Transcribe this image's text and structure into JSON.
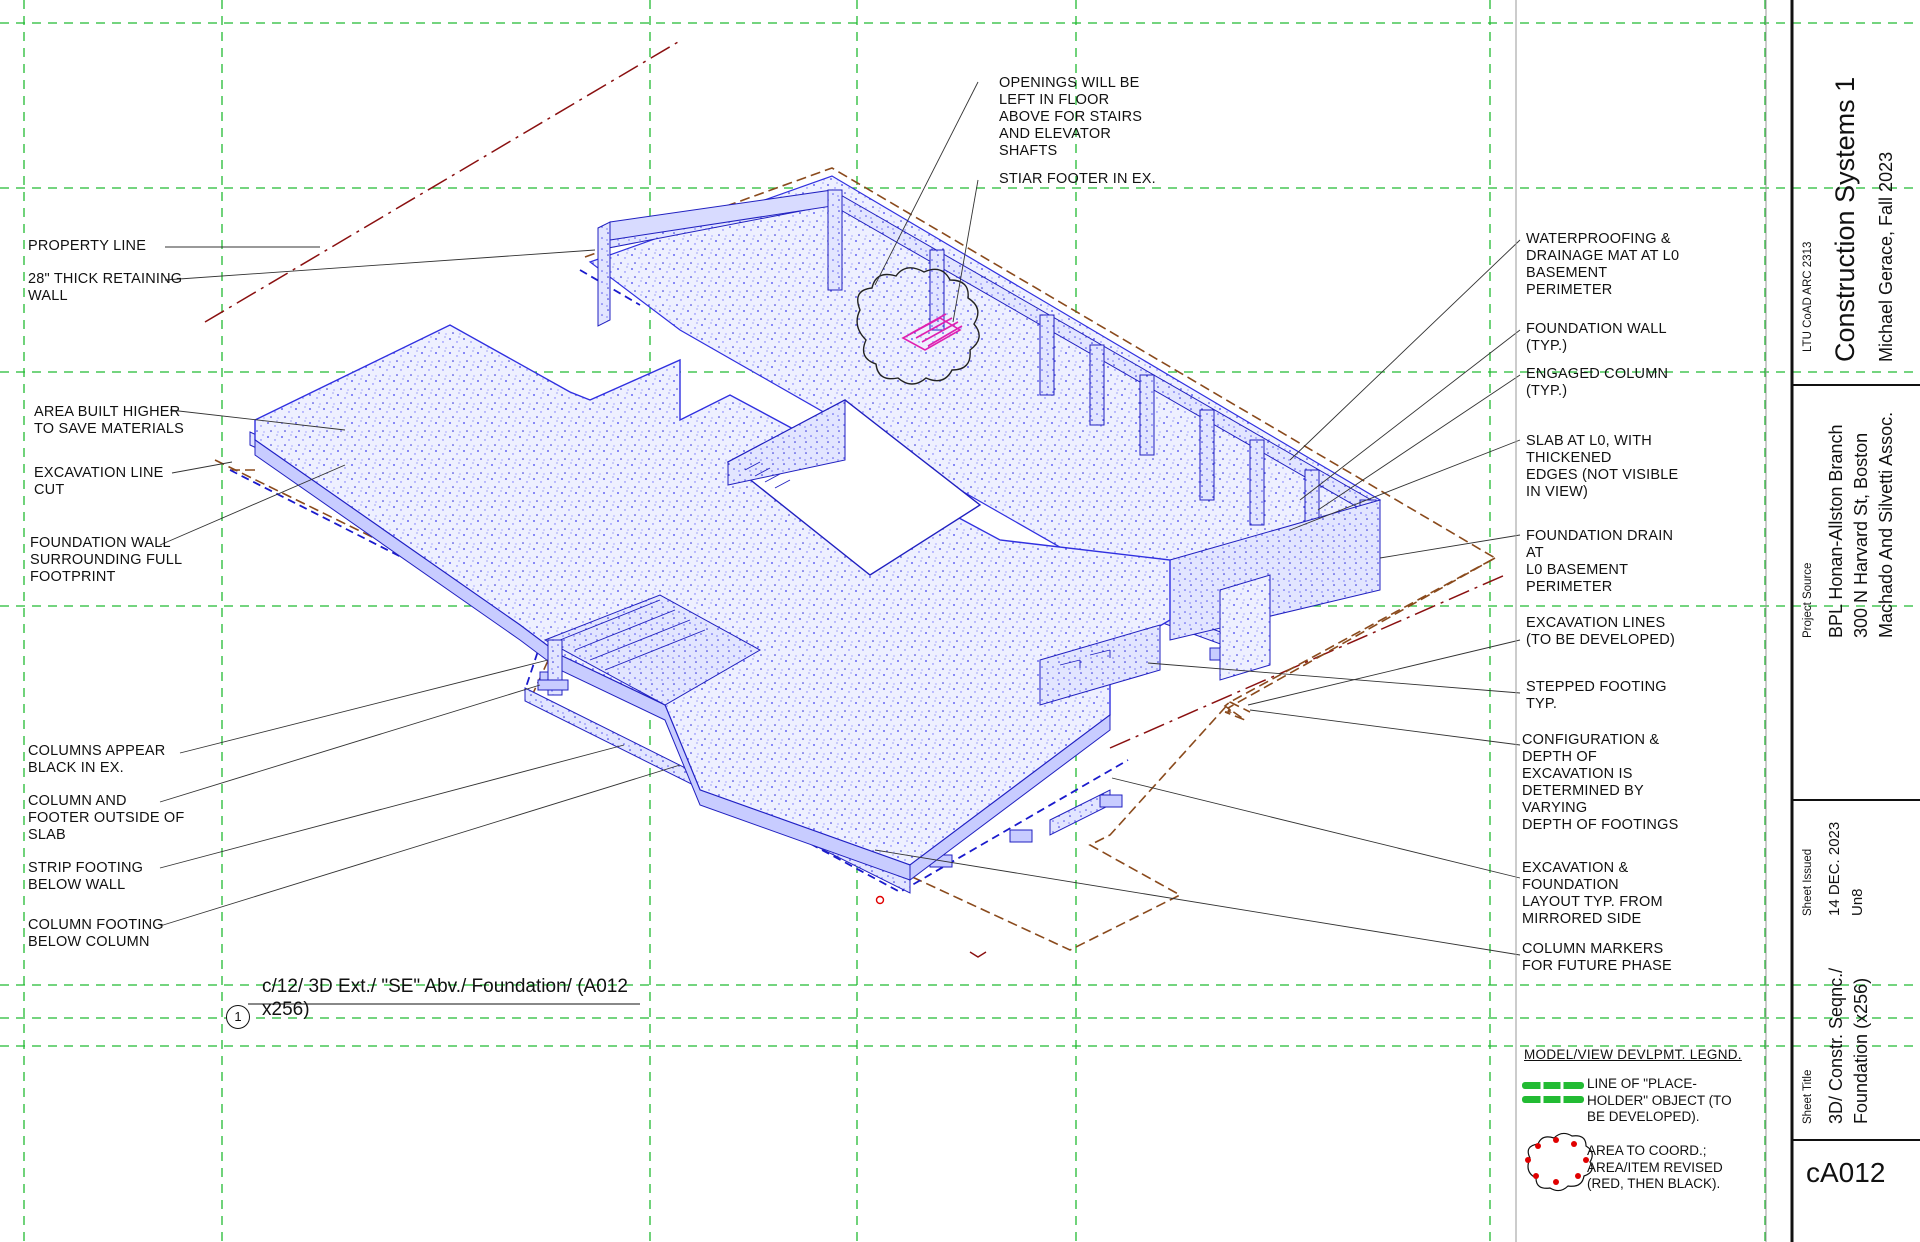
{
  "view": {
    "number": "1",
    "title_line1": "c/12/  3D Ext./ \"SE\" Abv./ Foundation/ (A012",
    "title_line2": "x256)"
  },
  "notes_left": [
    {
      "id": "property-line",
      "text": "PROPERTY LINE"
    },
    {
      "id": "retaining-wall",
      "text": "28\" THICK RETAINING\nWALL"
    },
    {
      "id": "area-built-higher",
      "text": "AREA BUILT HIGHER\nTO SAVE MATERIALS"
    },
    {
      "id": "excavation-line-cut",
      "text": "EXCAVATION LINE\nCUT"
    },
    {
      "id": "foundation-wall-surrounding",
      "text": "FOUNDATION WALL\nSURROUNDING FULL\nFOOTPRINT"
    },
    {
      "id": "columns-appear-black",
      "text": "COLUMNS APPEAR\nBLACK IN EX."
    },
    {
      "id": "column-footer-outside",
      "text": "COLUMN AND\nFOOTER OUTSIDE OF\nSLAB"
    },
    {
      "id": "strip-footing",
      "text": "STRIP FOOTING\nBELOW WALL"
    },
    {
      "id": "column-footing",
      "text": "COLUMN FOOTING\nBELOW COLUMN"
    }
  ],
  "notes_top": [
    {
      "id": "openings",
      "text": "OPENINGS WILL BE\nLEFT IN FLOOR\nABOVE FOR STAIRS\nAND ELEVATOR\nSHAFTS"
    },
    {
      "id": "stair-footer",
      "text": "STIAR FOOTER IN EX."
    }
  ],
  "notes_right": [
    {
      "id": "waterproofing",
      "text": "WATERPROOFING &\nDRAINAGE MAT AT L0\nBASEMENT\nPERIMETER"
    },
    {
      "id": "foundation-wall-typ",
      "text": "FOUNDATION WALL\n(TYP.)"
    },
    {
      "id": "engaged-column",
      "text": "ENGAGED COLUMN\n(TYP.)"
    },
    {
      "id": "slab-at-l0",
      "text": "SLAB AT L0, WITH\nTHICKENED\nEDGES (NOT VISIBLE\nIN VIEW)"
    },
    {
      "id": "foundation-drain",
      "text": "FOUNDATION DRAIN\nAT\nL0 BASEMENT\nPERIMETER"
    },
    {
      "id": "excavation-lines",
      "text": "EXCAVATION LINES\n(TO BE DEVELOPED)"
    },
    {
      "id": "stepped-footing",
      "text": "STEPPED FOOTING\nTYP."
    },
    {
      "id": "configuration",
      "text": "CONFIGURATION &\nDEPTH OF\nEXCAVATION IS\nDETERMINED BY\nVARYING\nDEPTH OF FOOTINGS"
    },
    {
      "id": "excavation-layout",
      "text": "EXCAVATION &\nFOUNDATION\nLAYOUT TYP. FROM\nMIRRORED SIDE"
    },
    {
      "id": "column-markers",
      "text": "COLUMN MARKERS\nFOR FUTURE PHASE"
    }
  ],
  "legend": {
    "title": "MODEL/VIEW DEVLPMT. LEGND.",
    "items": [
      {
        "text": "LINE OF \"PLACE-\nHOLDER\" OBJECT (TO\nBE DEVELOPED).",
        "icon": "placeholder-line-icon"
      },
      {
        "text": "AREA TO COORD.;\nAREA/ITEM REVISED\n(RED, THEN BLACK).",
        "icon": "revision-cloud-icon"
      }
    ]
  },
  "title_block": {
    "course": "LTU CoAD ARC 2313",
    "course_title": "Construction Systems 1",
    "author": "Michael Gerace, Fall 2023",
    "project_source_label": "Project Source",
    "project_line1": "BPL Honan-Allston Branch",
    "project_line2": "300 N Harvard St, Boston",
    "project_line3": "Machado And Silvetti Assoc.",
    "sheet_issued_label": "Sheet Issued",
    "issue_date": "14 DEC. 2023",
    "issue_code": "Un8",
    "sheet_title_label": "Sheet Title",
    "sheet_title_line1": "3D/ Constr. Seqnc./",
    "sheet_title_line2": "Foundation (x256)",
    "sheet_number": "cA012"
  },
  "colors": {
    "grid_green": "#22bb33",
    "model_blue": "#3d3df0",
    "excavation_brown": "#8a4a1c",
    "property_line": "#8a1010",
    "stair_magenta": "#e020b0",
    "revision_red": "#e00000"
  }
}
